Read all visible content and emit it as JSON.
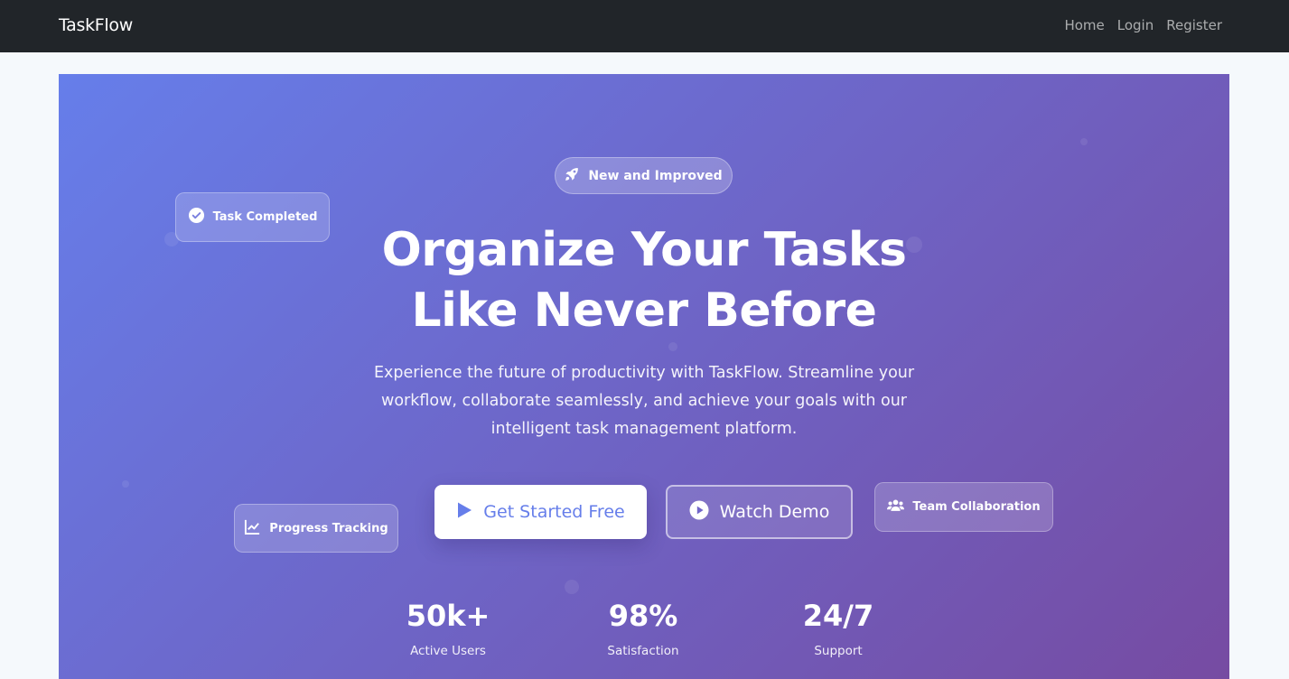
{
  "navbar": {
    "brand": "TaskFlow",
    "links": [
      "Home",
      "Login",
      "Register"
    ]
  },
  "hero": {
    "badge": {
      "icon": "rocket-icon",
      "label": "New and Improved"
    },
    "headline": [
      "Organize Your Tasks",
      "Like Never Before"
    ],
    "subtitle": [
      "Experience the future of productivity with TaskFlow. Streamline your",
      "workflow, collaborate seamlessly, and achieve your goals with our",
      "intelligent task management platform."
    ],
    "buttons": {
      "primary": {
        "icon": "play-icon",
        "label": "Get Started Free"
      },
      "secondary": {
        "icon": "play-circle-icon",
        "label": "Watch Demo"
      }
    },
    "floating_cards": {
      "task": {
        "icon": "check-circle-icon",
        "label": "Task Completed"
      },
      "progress": {
        "icon": "chart-line-icon",
        "label": "Progress Tracking"
      },
      "team": {
        "icon": "users-icon",
        "label": "Team Collaboration"
      }
    },
    "stats": [
      {
        "value": "50k+",
        "label": "Active Users"
      },
      {
        "value": "98%",
        "label": "Satisfaction"
      },
      {
        "value": "24/7",
        "label": "Support"
      }
    ]
  },
  "colors": {
    "navbar_bg": "#212529",
    "gradient_start": "#667eea",
    "gradient_end": "#764ba2",
    "page_bg": "#f5f9fc",
    "primary_button_text": "#667eea"
  }
}
